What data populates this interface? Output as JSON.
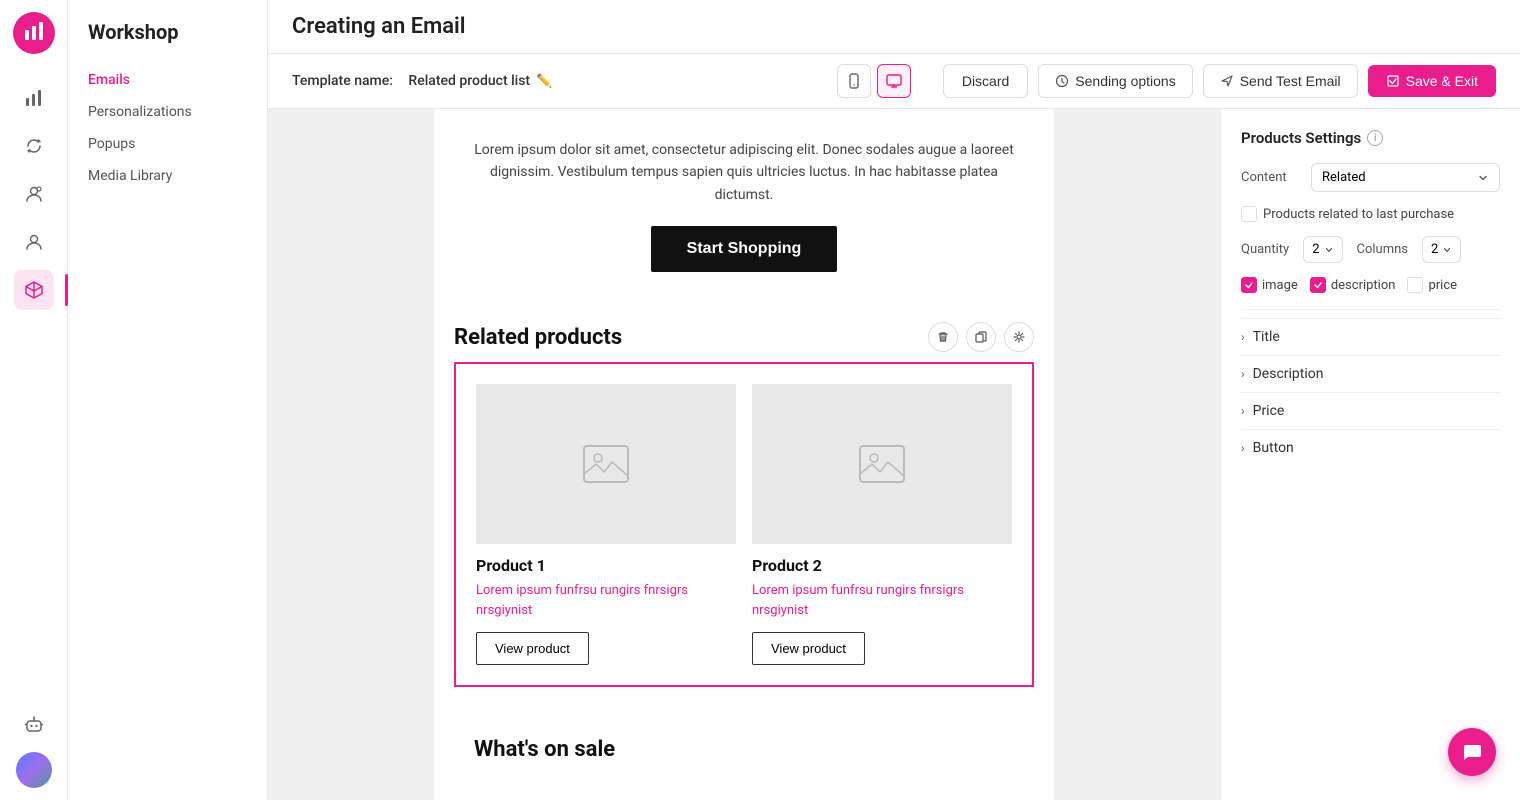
{
  "app": {
    "name": "Workshop",
    "logo_icon": "📊"
  },
  "sidebar": {
    "items": [
      {
        "id": "emails",
        "label": "Emails",
        "active": true
      },
      {
        "id": "personalizations",
        "label": "Personalizations",
        "active": false
      },
      {
        "id": "popups",
        "label": "Popups",
        "active": false
      },
      {
        "id": "media_library",
        "label": "Media Library",
        "active": false
      }
    ]
  },
  "header": {
    "title": "Creating an Email",
    "template_name_prefix": "Template name:",
    "template_name": "Related product list",
    "discard_label": "Discard",
    "sending_options_label": "Sending options",
    "send_test_label": "Send Test Email",
    "save_label": "Save & Exit"
  },
  "canvas": {
    "lorem_text": "Lorem ipsum dolor sit amet, consectetur adipiscing elit. Donec sodales augue a laoreet dignissim. Vestibulum tempus sapien quis ultricies luctus. In hac habitasse platea dictumst.",
    "cta_button": "Start Shopping",
    "related_products_title": "Related products",
    "products": [
      {
        "name": "Product 1",
        "description": "Lorem ipsum funfrsu rungirs fnrsigrs nrsgiynist",
        "button": "View product"
      },
      {
        "name": "Product 2",
        "description": "Lorem ipsum funfrsu rungirs fnrsigrs nrsgiynist",
        "button": "View product"
      }
    ],
    "sale_section_title": "What's on sale"
  },
  "right_panel": {
    "title": "Products Settings",
    "content_label": "Content",
    "content_value": "Related",
    "related_checkbox_label": "Products related to last purchase",
    "quantity_label": "Quantity",
    "quantity_value": "2",
    "columns_label": "Columns",
    "columns_value": "2",
    "toggles": [
      {
        "id": "image",
        "label": "image",
        "checked": true
      },
      {
        "id": "description",
        "label": "description",
        "checked": true
      },
      {
        "id": "price",
        "label": "price",
        "checked": false
      }
    ],
    "expandables": [
      {
        "id": "title",
        "label": "Title"
      },
      {
        "id": "description",
        "label": "Description"
      },
      {
        "id": "price",
        "label": "Price"
      },
      {
        "id": "button",
        "label": "Button"
      }
    ]
  },
  "nav_icons": [
    {
      "id": "bar-chart",
      "icon": "bar_chart",
      "active": false
    },
    {
      "id": "sync",
      "icon": "sync",
      "active": false
    },
    {
      "id": "person-circle",
      "icon": "person_circle",
      "active": false
    },
    {
      "id": "person",
      "icon": "person",
      "active": false
    },
    {
      "id": "cube",
      "icon": "cube",
      "active": true
    },
    {
      "id": "bot",
      "icon": "bot",
      "active": false
    }
  ]
}
